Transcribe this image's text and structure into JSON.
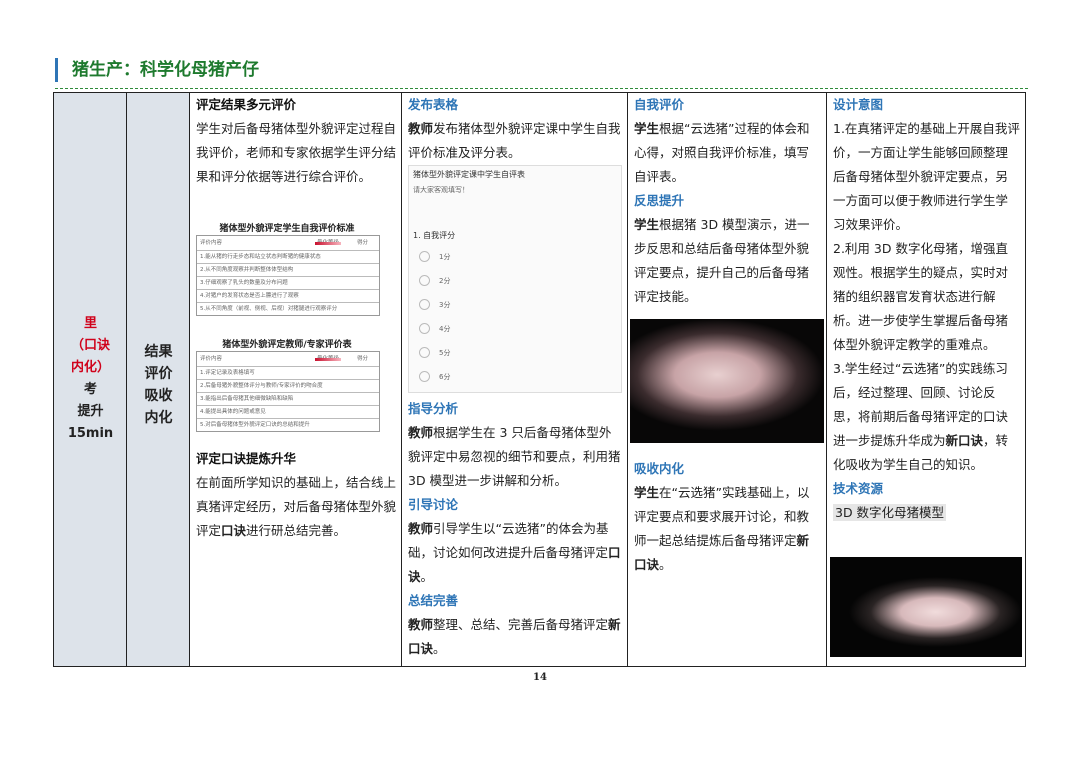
{
  "header": {
    "title": "猪生产：科学化母猪产仔"
  },
  "stage": {
    "line1": "里",
    "line2": "（口诀",
    "line3": "内化）",
    "line4": "考",
    "line5": "提升",
    "time": "15min"
  },
  "substage": {
    "l1": "结果",
    "l2": "评价",
    "l3": "吸收",
    "l4": "内化"
  },
  "col3": {
    "h1": "评定结果多元评价",
    "p1": "学生对后备母猪体型外貌评定过程自我评价，老师和专家依据学生评分结果和评分依据等进行综合评价。",
    "table1_title": "猪体型外貌评定学生自我评价标准",
    "table2_title": "猪体型外貌评定教师/专家评价表",
    "table_head": "评价内容",
    "table_score_label": "量化等级",
    "table_score_col": "得分",
    "t1_rows": [
      "1.能从猪的行走步态和站立状态判断猪的健康状态",
      "2.从不同角度观察并判断整体体型结构",
      "3.仔细观察了乳头的数量及分布问题",
      "4.对猪户的发育状态是否上膘进行了观察",
      "5.从不同角度（前视、侧视、后视）对猪腿进行观察评分"
    ],
    "t2_rows": [
      "1.评定记录及表格填写",
      "2.后备母猪外貌整体评分与教师/专家评价的吻合度",
      "3.能指出后备母猪其他细微缺陷和缺陷",
      "4.能提出具体的问题或意见",
      "5.对后备母猪体型外貌评定口诀的总结和提升"
    ],
    "h2": "评定口诀提炼升华",
    "p2a": "在前面所学知识的基础上，结合线上真猪评定经历，对后备母猪体型外貌评定",
    "p2b": "口诀",
    "p2c": "进行研总结完善。"
  },
  "col4": {
    "h1": "发布表格",
    "p1a": "教师",
    "p1b": "发布猪体型外貌评定课中学生自我评价标准及评分表。",
    "form_title": "猪体型外貌评定课中学生自评表",
    "form_sub": "请大家客观填写！",
    "form_q": "1. 自我评分",
    "form_options": [
      "1分",
      "2分",
      "3分",
      "4分",
      "5分",
      "6分"
    ],
    "h2": "指导分析",
    "p2a": "教师",
    "p2b": "根据学生在 3 只后备母猪体型外貌评定中易忽视的细节和要点，利用猪 3D 模型进一步讲解和分析。",
    "h3": "引导讨论",
    "p3a": "教师",
    "p3b": "引导学生以“云选猪”的体会为基础，讨论如何改进提升后备母猪评定",
    "p3c": "口诀",
    "p3d": "。",
    "h4": "总结完善",
    "p4a": "教师",
    "p4b": "整理、总结、完善后备母猪评定",
    "p4c": "新口诀",
    "p4d": "。"
  },
  "col5": {
    "h1": "自我评价",
    "p1a": "学生",
    "p1b": "根据“云选猪”过程的体会和心得，对照自我评价标准，填写自评表。",
    "h2": "反思提升",
    "p2a": "学生",
    "p2b": "根据猪 3D 模型演示，进一步反思和总结后备母猪体型外貌评定要点，提升自己的后备母猪评定技能。",
    "h3": "吸收内化",
    "p3a": "学生",
    "p3b": "在“云选猪”实践基础上，以评定要点和要求展开讨论，和教师一起总结提炼后备母猪评定",
    "p3c": "新口诀",
    "p3d": "。"
  },
  "col6": {
    "h1": "设计意图",
    "p1": "1.在真猪评定的基础上开展自我评价，一方面让学生能够回顾整理后备母猪体型外貌评定要点，另一方面可以便于教师进行学生学习效果评价。",
    "p2": "2.利用 3D 数字化母猪，增强直观性。根据学生的疑点，实时对猪的组织器官发育状态进行解析。进一步使学生掌握后备母猪体型外貌评定教学的重难点。",
    "p3a": "3.学生经过“云选猪”的实践练习后，经过整理、回顾、讨论反思，将前期后备母猪评定的口诀进一步提炼升华成为",
    "p3b": "新口诀",
    "p3c": "，转化吸收为学生自己的知识。",
    "h2": "技术资源",
    "res": "3D 数字化母猪模型"
  },
  "page": {
    "number": "14"
  },
  "colors": {
    "header": "#1e7a2e",
    "accent": "#2e75b6",
    "stage": "#d0021b",
    "side_bg": "#dde3ea"
  }
}
